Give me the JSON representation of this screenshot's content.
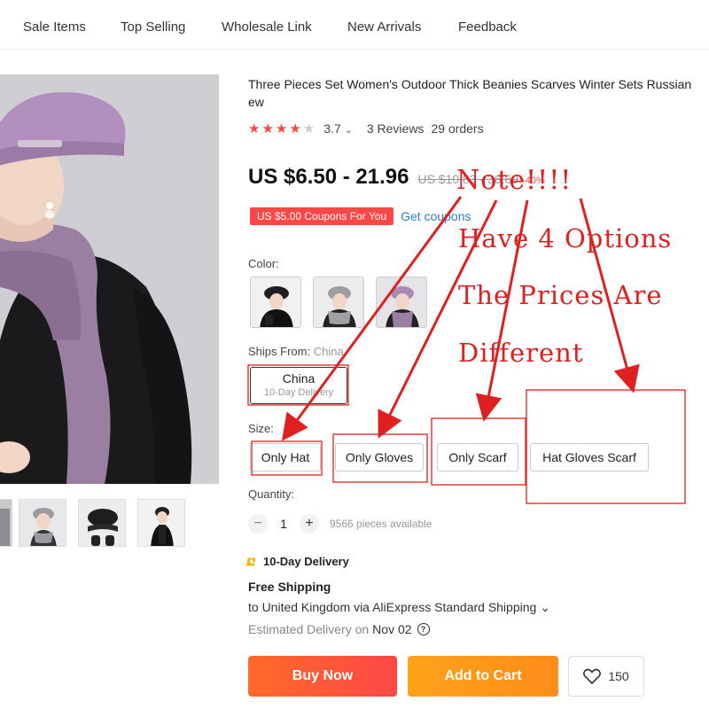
{
  "nav": {
    "items": [
      "Sale Items",
      "Top Selling",
      "Wholesale Link",
      "New Arrivals",
      "Feedback"
    ]
  },
  "product": {
    "title": "Three Pieces Set Women's Outdoor Thick Beanies Scarves Winter Sets Russian ew",
    "stars": 4,
    "rating": "3.7",
    "rating_caret": "⌄",
    "reviews": "3 Reviews",
    "orders": "29 orders",
    "price": "US $6.50 - 21.96",
    "old_price": "US $10.83 - 36.60",
    "discount": "-40%",
    "coupon": "US $5.00 Coupons For You",
    "get_coupons": "Get coupons"
  },
  "color": {
    "label": "Color:",
    "options": [
      "hat-gloves-option",
      "hat-scarf-option",
      "scarf-option"
    ]
  },
  "ships_from": {
    "label": "Ships From:",
    "value": "China",
    "option_country": "China",
    "option_delivery": "10-Day Delivery"
  },
  "size": {
    "label": "Size:",
    "options": [
      "Only Hat",
      "Only Gloves",
      "Only Scarf",
      "Hat Gloves Scarf"
    ]
  },
  "quantity": {
    "label": "Quantity:",
    "minus": "−",
    "value": "1",
    "plus": "+",
    "available": "9566 pieces available"
  },
  "shipping": {
    "badge": "10-Day Delivery",
    "free": "Free Shipping",
    "to": "to United Kingdom via AliExpress Standard Shipping ⌄",
    "est_label": "Estimated Delivery on",
    "est_date": "Nov 02",
    "help": "?"
  },
  "actions": {
    "buy_now": "Buy Now",
    "add_to_cart": "Add to Cart",
    "wishlist_count": "150"
  },
  "annotation": {
    "line1": "Note!!!!",
    "line2": "Have 4 Options",
    "line3": "The Prices Are",
    "line4": "Different"
  },
  "colors": {
    "accent_red": "#ff4747",
    "annotation_red": "#e02020",
    "buy_now": "#ff4747",
    "add_to_cart": "#ff9a1a",
    "link_blue": "#2a7dd4"
  }
}
